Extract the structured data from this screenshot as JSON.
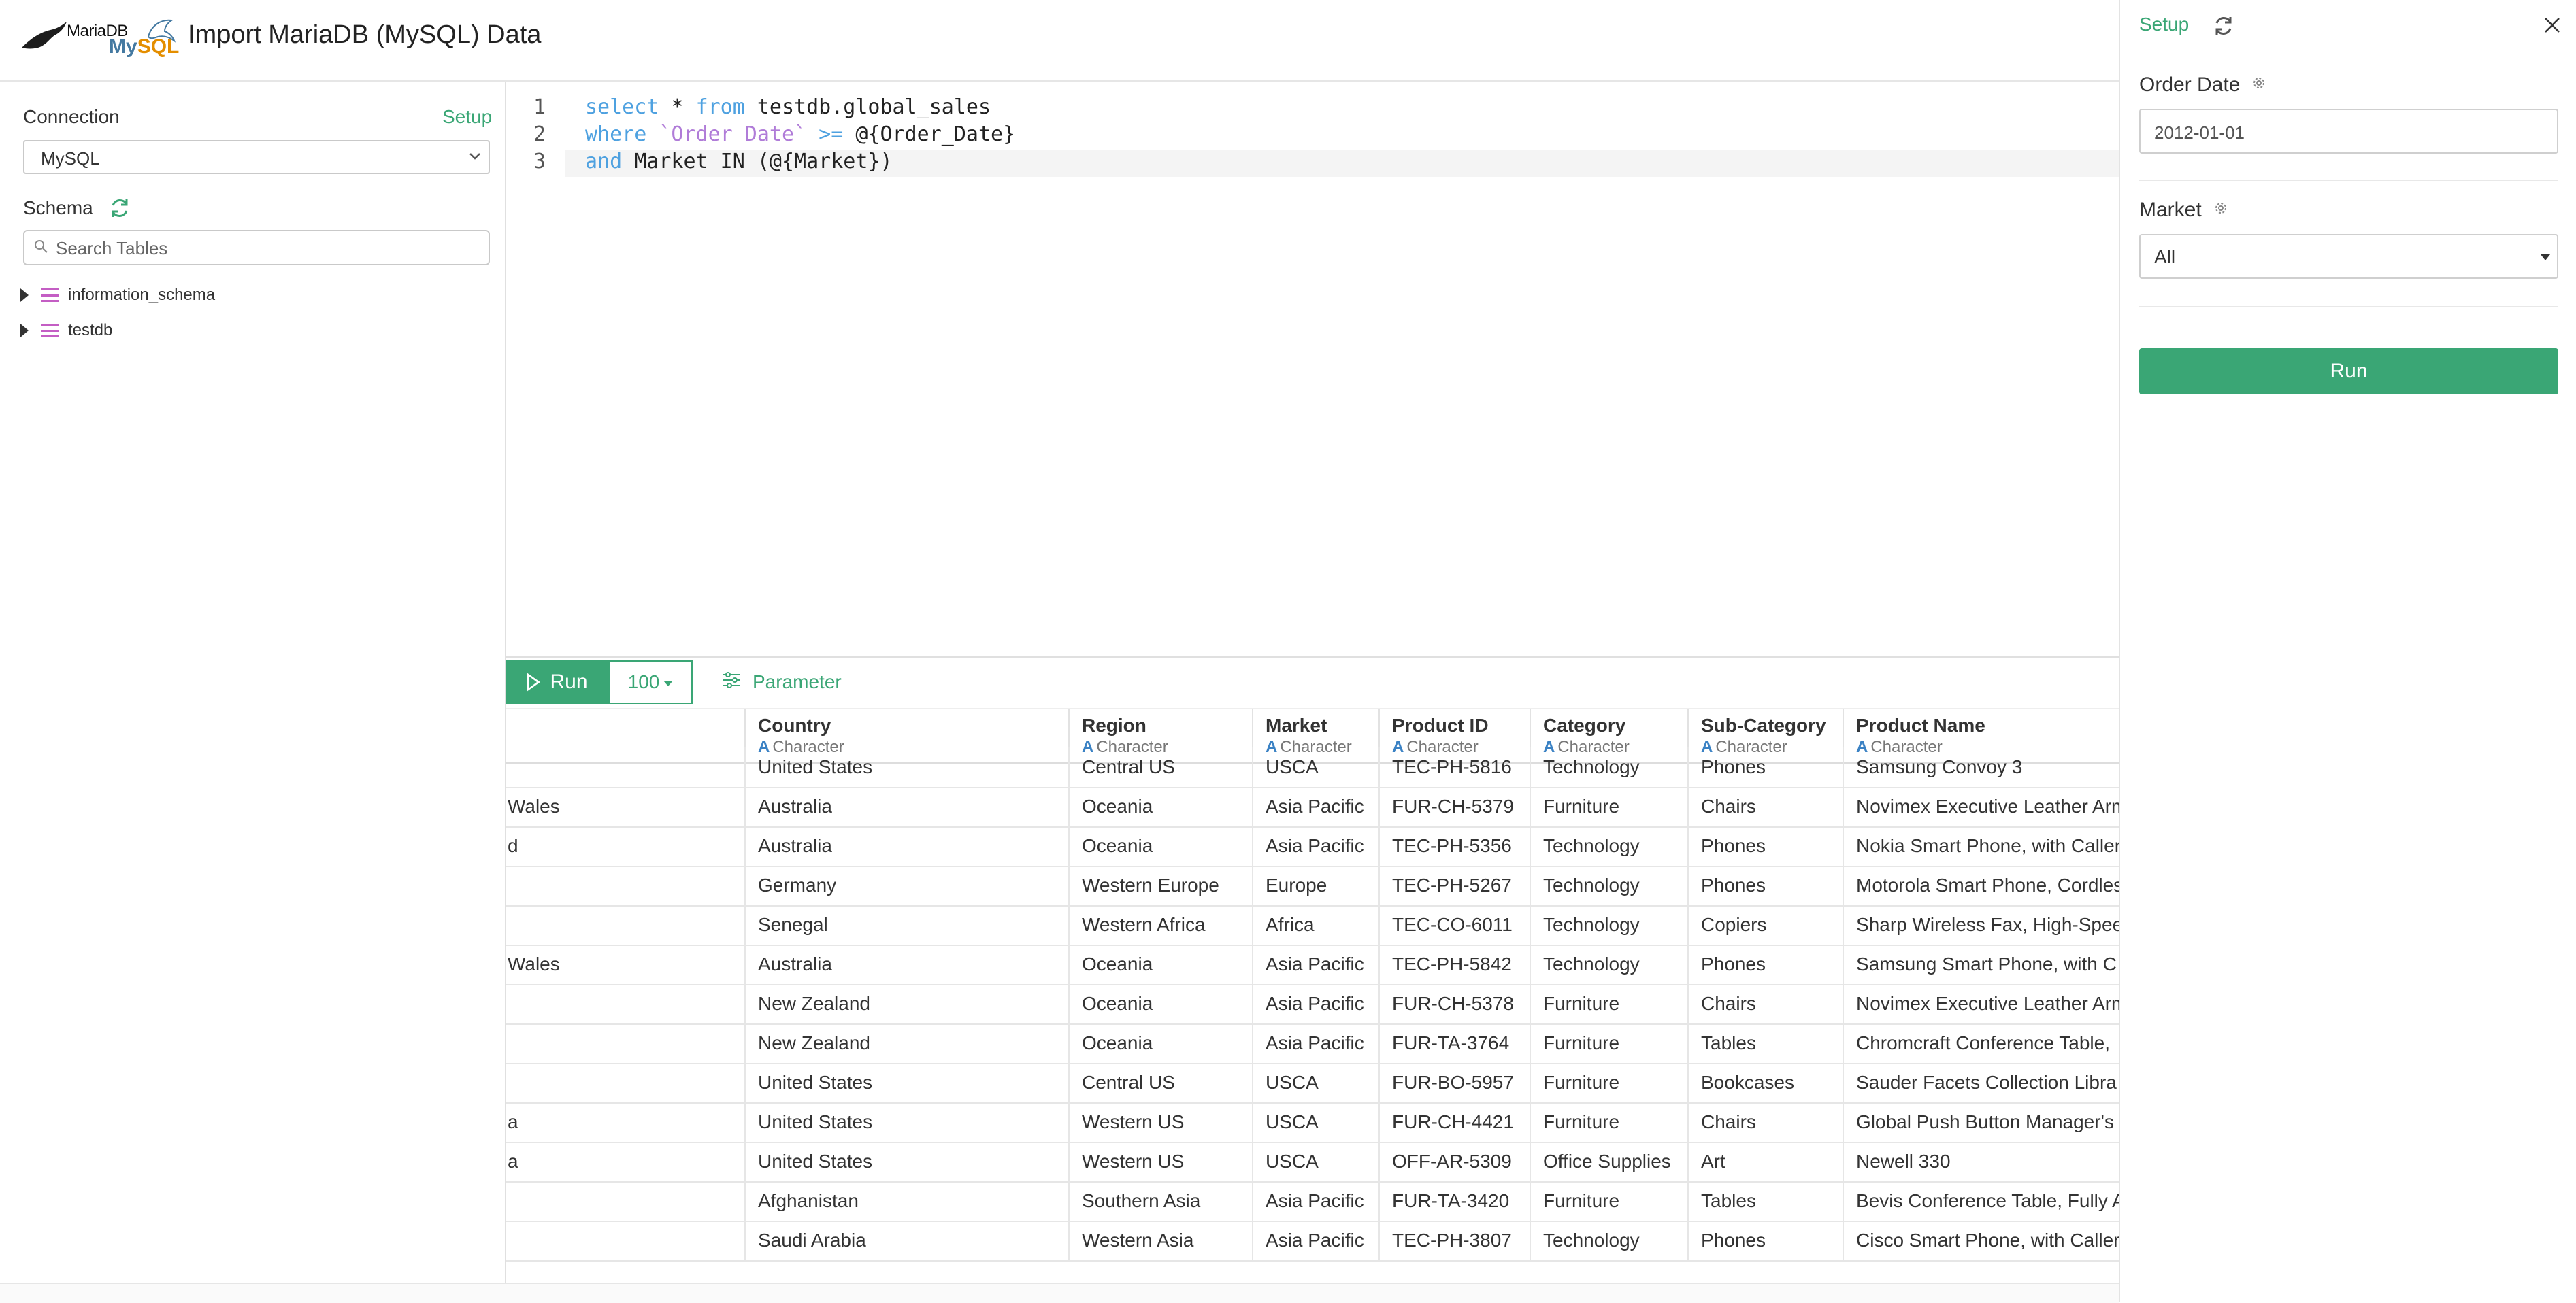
{
  "header": {
    "logo_text_1": "MariaDB",
    "logo_text_2": "My",
    "logo_text_3": "SQL",
    "title": "Import MariaDB (MySQL) Data"
  },
  "left": {
    "connection_label": "Connection",
    "setup_link": "Setup",
    "connection_value": "MySQL",
    "schema_label": "Schema",
    "search_placeholder": "Search Tables",
    "tree": [
      {
        "label": "information_schema"
      },
      {
        "label": "testdb"
      }
    ]
  },
  "editor": {
    "lines": [
      {
        "n": "1"
      },
      {
        "n": "2"
      },
      {
        "n": "3"
      }
    ],
    "tokens": {
      "l1_select": "select",
      "l1_star": " * ",
      "l1_from": "from",
      "l1_rest": " testdb.global_sales",
      "l2_where": "where",
      "l2_col": " `Order Date`",
      "l2_op": " >=",
      "l2_rest": " @{Order_Date}",
      "l3_and": "and",
      "l3_rest": " Market IN (@{Market})"
    }
  },
  "toolbar": {
    "run_label": "Run",
    "limit_value": "100",
    "parameter_label": "Parameter"
  },
  "table": {
    "type_marker": "A",
    "columns": [
      {
        "name": "",
        "type": ""
      },
      {
        "name": "Country",
        "type": "Character"
      },
      {
        "name": "Region",
        "type": "Character"
      },
      {
        "name": "Market",
        "type": "Character"
      },
      {
        "name": "Product ID",
        "type": "Character"
      },
      {
        "name": "Category",
        "type": "Character"
      },
      {
        "name": "Sub-Category",
        "type": "Character"
      },
      {
        "name": "Product Name",
        "type": "Character"
      }
    ],
    "rows": [
      [
        "",
        "United States",
        "Central US",
        "USCA",
        "TEC-PH-5816",
        "Technology",
        "Phones",
        "Samsung Convoy 3"
      ],
      [
        "Wales",
        "Australia",
        "Oceania",
        "Asia Pacific",
        "FUR-CH-5379",
        "Furniture",
        "Chairs",
        "Novimex Executive Leather Arm"
      ],
      [
        "d",
        "Australia",
        "Oceania",
        "Asia Pacific",
        "TEC-PH-5356",
        "Technology",
        "Phones",
        "Nokia Smart Phone, with Caller"
      ],
      [
        "",
        "Germany",
        "Western Europe",
        "Europe",
        "TEC-PH-5267",
        "Technology",
        "Phones",
        "Motorola Smart Phone, Cordless"
      ],
      [
        "",
        "Senegal",
        "Western Africa",
        "Africa",
        "TEC-CO-6011",
        "Technology",
        "Copiers",
        "Sharp Wireless Fax, High-Speed"
      ],
      [
        "Wales",
        "Australia",
        "Oceania",
        "Asia Pacific",
        "TEC-PH-5842",
        "Technology",
        "Phones",
        "Samsung Smart Phone, with C"
      ],
      [
        "",
        "New Zealand",
        "Oceania",
        "Asia Pacific",
        "FUR-CH-5378",
        "Furniture",
        "Chairs",
        "Novimex Executive Leather Arm"
      ],
      [
        "",
        "New Zealand",
        "Oceania",
        "Asia Pacific",
        "FUR-TA-3764",
        "Furniture",
        "Tables",
        "Chromcraft Conference Table,"
      ],
      [
        "",
        "United States",
        "Central US",
        "USCA",
        "FUR-BO-5957",
        "Furniture",
        "Bookcases",
        "Sauder Facets Collection Libra"
      ],
      [
        "a",
        "United States",
        "Western US",
        "USCA",
        "FUR-CH-4421",
        "Furniture",
        "Chairs",
        "Global Push Button Manager's"
      ],
      [
        "a",
        "United States",
        "Western US",
        "USCA",
        "OFF-AR-5309",
        "Office Supplies",
        "Art",
        "Newell 330"
      ],
      [
        "",
        "Afghanistan",
        "Southern Asia",
        "Asia Pacific",
        "FUR-TA-3420",
        "Furniture",
        "Tables",
        "Bevis Conference Table, Fully A"
      ],
      [
        "",
        "Saudi Arabia",
        "Western Asia",
        "Asia Pacific",
        "TEC-PH-3807",
        "Technology",
        "Phones",
        "Cisco Smart Phone, with Caller"
      ]
    ]
  },
  "right": {
    "setup_label": "Setup",
    "order_date_label": "Order Date",
    "order_date_value": "2012-01-01",
    "market_label": "Market",
    "market_value": "All",
    "run_label": "Run"
  },
  "colors": {
    "accent": "#3aa675",
    "keyword": "#4ea1e0",
    "keyword_alt": "#b07cd8",
    "type_icon": "#3b82c4"
  }
}
